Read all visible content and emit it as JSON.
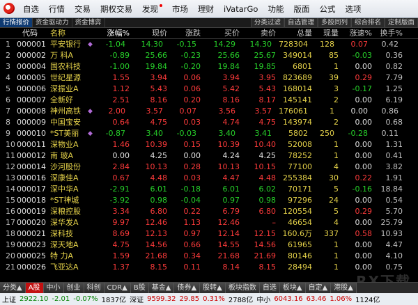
{
  "menu": [
    "自选",
    "行情",
    "交易",
    "期权交易",
    "发现",
    "市场",
    "理财",
    "iVatarGo",
    "功能",
    "版面",
    "公式",
    "选项"
  ],
  "tabs_left": [
    "行情报价",
    "资金驱动力",
    "资金博弈"
  ],
  "tabs_right": [
    "分类过滤",
    "自选管理",
    "多股同列",
    "综合排名",
    "定制版面"
  ],
  "columns": [
    "代码",
    "名称",
    "涨幅%",
    "现价",
    "涨跌",
    "买价",
    "卖价",
    "总量",
    "现量",
    "涨速%",
    "换手%"
  ],
  "rows": [
    [
      "1",
      "000001",
      "平安银行",
      "-1.04",
      "14.30",
      "-0.15",
      "14.29",
      "14.30",
      "728304",
      "128",
      "0.07",
      "0.42"
    ],
    [
      "2",
      "000002",
      "万 科A",
      "-0.89",
      "25.66",
      "-0.23",
      "25.66",
      "25.67",
      "349014",
      "85",
      "-0.03",
      "0.36"
    ],
    [
      "3",
      "000004",
      "国农科技",
      "-1.00",
      "19.84",
      "-0.20",
      "19.84",
      "19.85",
      "6801",
      "1",
      "0.00",
      "0.82"
    ],
    [
      "4",
      "000005",
      "世纪星源",
      "1.55",
      "3.94",
      "0.06",
      "3.94",
      "3.95",
      "823689",
      "39",
      "0.29",
      "7.79"
    ],
    [
      "5",
      "000006",
      "深振业A",
      "1.12",
      "5.43",
      "0.06",
      "5.42",
      "5.43",
      "168014",
      "3",
      "-0.17",
      "1.25"
    ],
    [
      "6",
      "000007",
      "全新好",
      "2.51",
      "8.16",
      "0.20",
      "8.16",
      "8.17",
      "145141",
      "2",
      "0.00",
      "6.19"
    ],
    [
      "7",
      "000008",
      "神州高铁",
      "2.00",
      "3.57",
      "0.07",
      "3.56",
      "3.57",
      "176061",
      "1",
      "0.00",
      "0.86"
    ],
    [
      "8",
      "000009",
      "中国宝安",
      "0.64",
      "4.75",
      "0.03",
      "4.74",
      "4.75",
      "143974",
      "2",
      "0.00",
      "0.68"
    ],
    [
      "9",
      "000010",
      "*ST美丽",
      "-0.87",
      "3.40",
      "-0.03",
      "3.40",
      "3.41",
      "5802",
      "250",
      "-0.28",
      "0.11"
    ],
    [
      "10",
      "000011",
      "深物业A",
      "1.46",
      "10.39",
      "0.15",
      "10.39",
      "10.40",
      "52008",
      "1",
      "0.00",
      "1.31"
    ],
    [
      "11",
      "000012",
      "南 玻A",
      "0.00",
      "4.25",
      "0.00",
      "4.24",
      "4.25",
      "78252",
      "1",
      "0.00",
      "0.41"
    ],
    [
      "12",
      "000014",
      "沙河股份",
      "2.84",
      "10.13",
      "0.28",
      "10.13",
      "10.15",
      "77100",
      "4",
      "0.00",
      "3.82"
    ],
    [
      "13",
      "000016",
      "深康佳A",
      "0.67",
      "4.48",
      "0.03",
      "4.47",
      "4.48",
      "255384",
      "30",
      "0.22",
      "1.91"
    ],
    [
      "14",
      "000017",
      "深中华A",
      "-2.91",
      "6.01",
      "-0.18",
      "6.01",
      "6.02",
      "70171",
      "5",
      "-0.16",
      "18.84"
    ],
    [
      "15",
      "000018",
      "*ST神城",
      "-3.92",
      "0.98",
      "-0.04",
      "0.97",
      "0.98",
      "97296",
      "24",
      "0.00",
      "0.54"
    ],
    [
      "16",
      "000019",
      "深粮控股",
      "3.34",
      "6.80",
      "0.22",
      "6.79",
      "6.80",
      "120554",
      "5",
      "0.29",
      "5.70"
    ],
    [
      "17",
      "000020",
      "深华发A",
      "9.97",
      "12.46",
      "1.13",
      "12.46",
      "–",
      "46654",
      "4",
      "0.00",
      "25.79"
    ],
    [
      "18",
      "000021",
      "深科技",
      "8.69",
      "12.13",
      "0.97",
      "12.14",
      "12.15",
      "160.6万",
      "337",
      "0.58",
      "10.93"
    ],
    [
      "19",
      "000023",
      "深天地A",
      "4.75",
      "14.56",
      "0.66",
      "14.55",
      "14.56",
      "61965",
      "1",
      "0.00",
      "4.47"
    ],
    [
      "20",
      "000025",
      "特 力A",
      "1.59",
      "21.68",
      "0.34",
      "21.68",
      "21.69",
      "80146",
      "1",
      "0.00",
      "4.10"
    ],
    [
      "21",
      "000026",
      "飞亚达A",
      "1.37",
      "8.15",
      "0.11",
      "8.14",
      "8.15",
      "28494",
      "1",
      "0.00",
      "0.75"
    ]
  ],
  "marks": {
    "1": "◆",
    "7": "◆",
    "9": "◆"
  },
  "bottom_tabs": [
    "分类▲",
    "A股",
    "中小",
    "创业",
    "科创",
    "CDR▲",
    "B股",
    "基金▲",
    "债券▲",
    "股转▲",
    "板块指数",
    "自选",
    "板块▲",
    "自定▲",
    "港股▲"
  ],
  "status": {
    "sh_label": "上证",
    "sh_index": "2922.10",
    "sh_chg": "-2.01",
    "sh_pct": "-0.07%",
    "sh_amt": "1837亿",
    "sz_label": "深证",
    "sz_index": "9599.32",
    "sz_chg": "29.85",
    "sz_pct": "0.31%",
    "sz_amt": "2788亿",
    "zx_label": "中小",
    "zx_index": "6043.16",
    "zx_chg": "63.46",
    "zx_pct": "1.06%",
    "zx_amt": "1124亿"
  },
  "watermark": "RX下载"
}
